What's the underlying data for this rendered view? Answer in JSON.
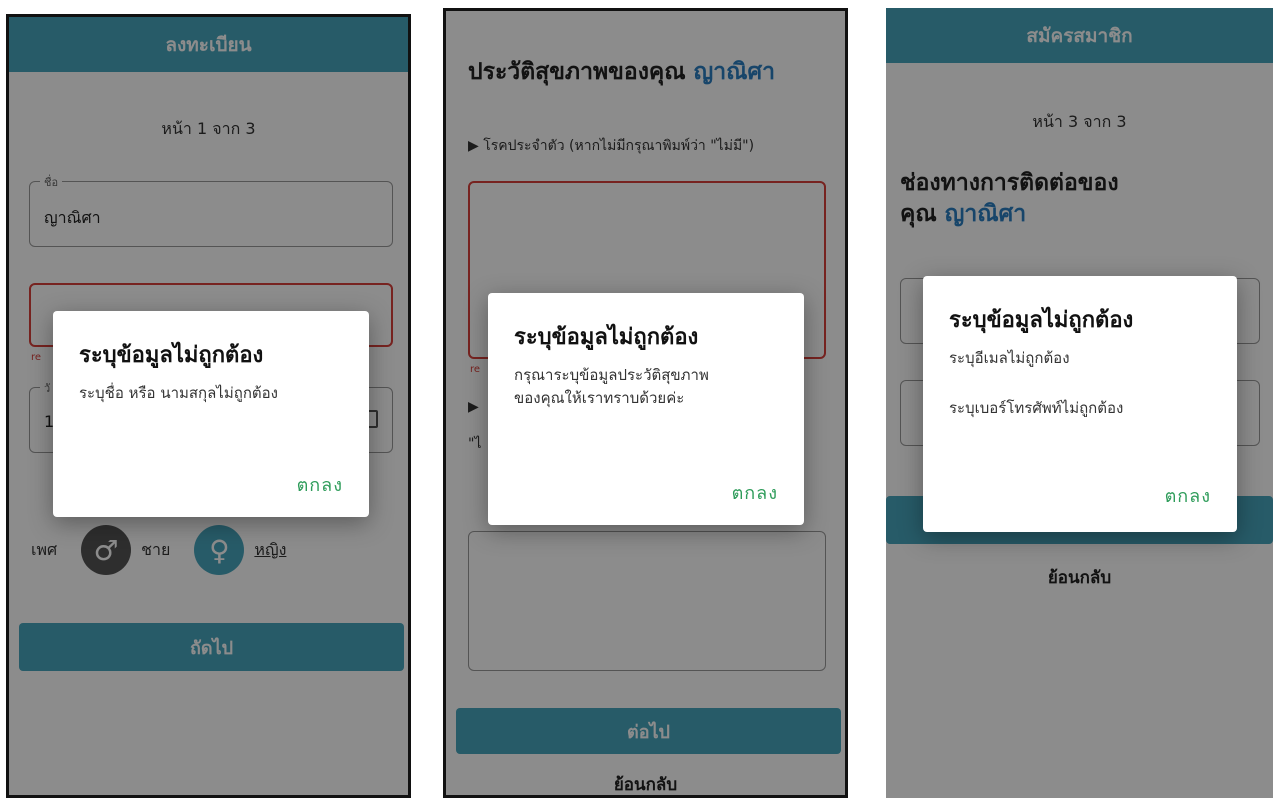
{
  "screen1": {
    "header": "ลงทะเบียน",
    "page": "หน้า 1 จาก 3",
    "first_name": {
      "label": "ชื่อ",
      "value": "ญาณิศา"
    },
    "gender": {
      "label": "เพศ",
      "male": "ชาย",
      "female": "หญิง"
    },
    "next_button": "ถัดไป",
    "dialog": {
      "title": "ระบุข้อมูลไม่ถูกต้อง",
      "message": "ระบุชื่อ หรือ นามสกุลไม่ถูกต้อง",
      "ok": "ตกลง"
    }
  },
  "screen2": {
    "title_prefix": "ประวัติสุขภาพของคุณ",
    "title_name": "ญาณิศา",
    "question": "▶ โรคประจำตัว (หากไม่มีกรุณาพิมพ์ว่า \"ไม่มี\")",
    "back_link": "ย้อนกลับ",
    "dialog": {
      "title": "ระบุข้อมูลไม่ถูกต้อง",
      "message_line1": "กรุณาระบุข้อมูลประวัติสุขภาพ",
      "message_line2": "ของคุณให้เราทราบด้วยค่ะ",
      "ok": "ตกลง"
    }
  },
  "screen3": {
    "header": "สมัครสมาชิก",
    "page": "หน้า 3 จาก 3",
    "title_line1": "ช่องทางการติดต่อของ",
    "title_prefix": "คุณ",
    "title_name": "ญาณิศา",
    "back_link": "ย้อนกลับ",
    "dialog": {
      "title": "ระบุข้อมูลไม่ถูกต้อง",
      "message_email": "ระบุอีเมลไม่ถูกต้อง",
      "message_phone": "ระบุเบอร์โทรศัพท์ไม่ถูกต้อง",
      "ok": "ตกลง"
    }
  },
  "colors": {
    "primary": "#48a6bd",
    "error": "#d9413b",
    "accent": "#2a7fc1",
    "ok": "#2e9c5a"
  }
}
